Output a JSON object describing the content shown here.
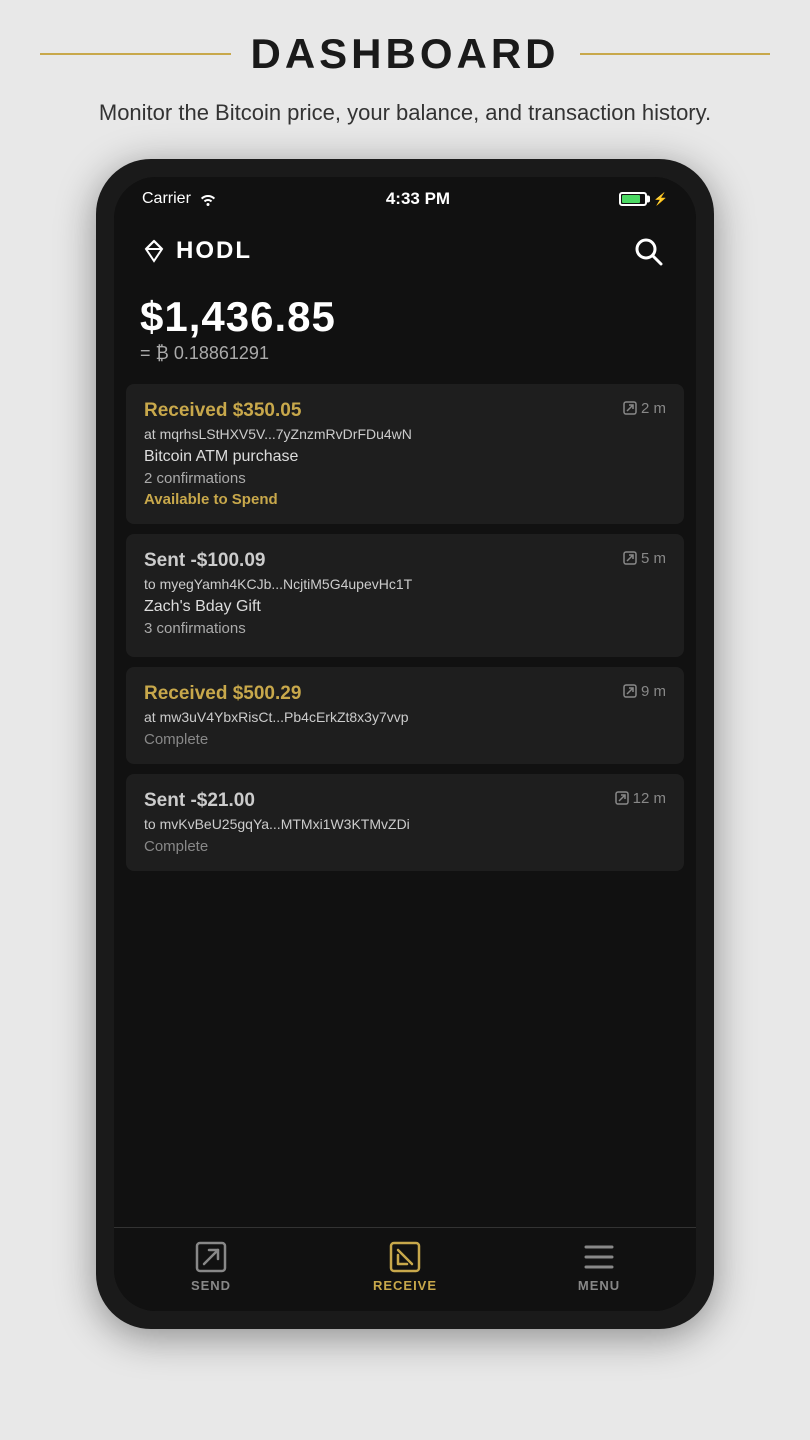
{
  "page": {
    "title": "DASHBOARD",
    "subtitle": "Monitor the Bitcoin price, your balance, and transaction history."
  },
  "status_bar": {
    "carrier": "Carrier",
    "time": "4:33 PM"
  },
  "app_header": {
    "logo_text": "HODL"
  },
  "balance": {
    "usd": "$1,436.85",
    "btc_prefix": "= ₿",
    "btc_value": "0.18861291"
  },
  "transactions": [
    {
      "type": "received",
      "amount": "Received $350.05",
      "address": "at mqrhsLStHXV5V...7yZnzmRvDrFDu4wN",
      "label": "Bitcoin ATM purchase",
      "confirmations": "2 confirmations",
      "status": "Available to Spend",
      "time": "2 m"
    },
    {
      "type": "sent",
      "amount": "Sent -$100.09",
      "address": "to myegYamh4KCJb...NcjtiM5G4upevHc1T",
      "label": "Zach's Bday Gift",
      "confirmations": "3 confirmations",
      "status": "",
      "time": "5 m"
    },
    {
      "type": "received",
      "amount": "Received $500.29",
      "address": "at mw3uV4YbxRisCt...Pb4cErkZt8x3y7vvp",
      "label": "",
      "confirmations": "",
      "status": "Complete",
      "time": "9 m"
    },
    {
      "type": "sent",
      "amount": "Sent -$21.00",
      "address": "to mvKvBeU25gqYa...MTMxi1W3KTMvZDi",
      "label": "",
      "confirmations": "",
      "status": "Complete",
      "time": "12 m"
    }
  ],
  "nav": {
    "send_label": "SEND",
    "receive_label": "RECEIVE",
    "menu_label": "MENU"
  }
}
